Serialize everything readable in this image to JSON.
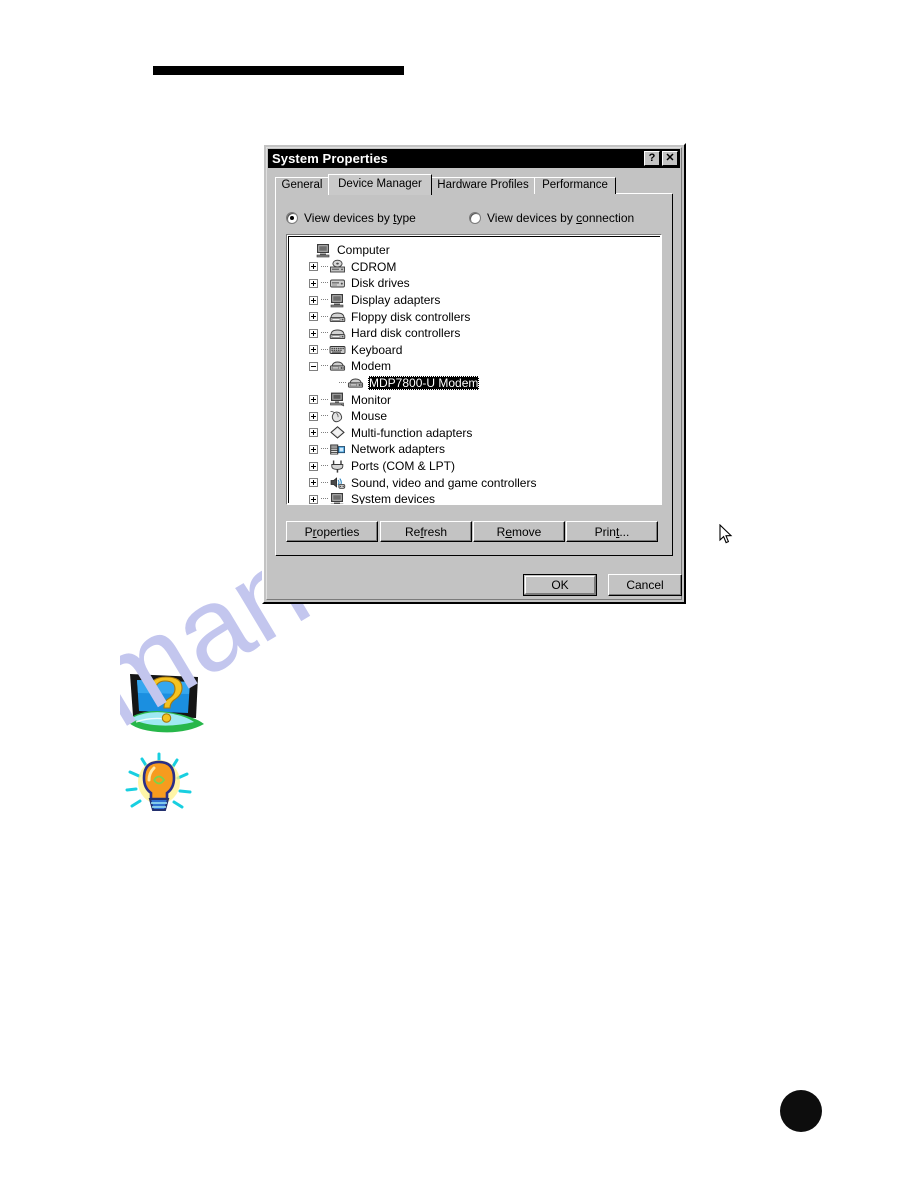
{
  "page": {
    "rule_color": "#000000",
    "page_bullet": "",
    "watermark_text": "manualshive.com",
    "watermark_color": "#c3c6ee"
  },
  "dialog": {
    "title": "System Properties",
    "titlebar_buttons": [
      {
        "name": "help-button",
        "glyph": "?"
      },
      {
        "name": "close-button",
        "glyph": "✕"
      }
    ],
    "tabs": [
      {
        "label": "General",
        "active": false
      },
      {
        "label": "Device Manager",
        "active": true
      },
      {
        "label": "Hardware Profiles",
        "active": false
      },
      {
        "label": "Performance",
        "active": false
      }
    ],
    "view_options": [
      {
        "label_pre": "View devices by ",
        "accel": "t",
        "label_post": "ype",
        "checked": true
      },
      {
        "label_pre": "View devices by ",
        "accel": "c",
        "label_post": "onnection",
        "checked": false
      }
    ],
    "device_tree": [
      {
        "label": "Computer",
        "depth": 0,
        "expander": "none",
        "icon": "computer-icon",
        "selected": false
      },
      {
        "label": "CDROM",
        "depth": 1,
        "expander": "plus",
        "icon": "cdrom-icon",
        "selected": false
      },
      {
        "label": "Disk drives",
        "depth": 1,
        "expander": "plus",
        "icon": "disk-drive-icon",
        "selected": false
      },
      {
        "label": "Display adapters",
        "depth": 1,
        "expander": "plus",
        "icon": "display-adapter-icon",
        "selected": false
      },
      {
        "label": "Floppy disk controllers",
        "depth": 1,
        "expander": "plus",
        "icon": "floppy-controller-icon",
        "selected": false
      },
      {
        "label": "Hard disk controllers",
        "depth": 1,
        "expander": "plus",
        "icon": "hard-disk-controller-icon",
        "selected": false
      },
      {
        "label": "Keyboard",
        "depth": 1,
        "expander": "plus",
        "icon": "keyboard-icon",
        "selected": false
      },
      {
        "label": "Modem",
        "depth": 1,
        "expander": "minus",
        "icon": "modem-icon",
        "selected": false
      },
      {
        "label": "MDP7800-U Modem",
        "depth": 2,
        "expander": "none",
        "icon": "modem-icon",
        "selected": true
      },
      {
        "label": "Monitor",
        "depth": 1,
        "expander": "plus",
        "icon": "monitor-icon",
        "selected": false
      },
      {
        "label": "Mouse",
        "depth": 1,
        "expander": "plus",
        "icon": "mouse-icon",
        "selected": false
      },
      {
        "label": "Multi-function adapters",
        "depth": 1,
        "expander": "plus",
        "icon": "multifunction-adapter-icon",
        "selected": false
      },
      {
        "label": "Network adapters",
        "depth": 1,
        "expander": "plus",
        "icon": "network-adapter-icon",
        "selected": false
      },
      {
        "label": "Ports (COM & LPT)",
        "depth": 1,
        "expander": "plus",
        "icon": "port-plug-icon",
        "selected": false
      },
      {
        "label": "Sound, video and game controllers",
        "depth": 1,
        "expander": "plus",
        "icon": "sound-game-icon",
        "selected": false
      },
      {
        "label": "System devices",
        "depth": 1,
        "expander": "plus",
        "icon": "system-device-icon",
        "selected": false
      }
    ],
    "action_buttons": [
      {
        "name": "properties-button",
        "pre": "P",
        "accel": "r",
        "post": "operties"
      },
      {
        "name": "refresh-button",
        "pre": "Re",
        "accel": "f",
        "post": "resh"
      },
      {
        "name": "remove-button",
        "pre": "R",
        "accel": "e",
        "post": "move"
      },
      {
        "name": "print-button",
        "pre": "Prin",
        "accel": "t",
        "post": "..."
      }
    ],
    "ok_label": "OK",
    "cancel_label": "Cancel"
  },
  "clipart": [
    {
      "name": "question-mark-clipart",
      "desc": "question-mark-icon"
    },
    {
      "name": "lightbulb-clipart",
      "desc": "lightbulb-icon"
    }
  ]
}
